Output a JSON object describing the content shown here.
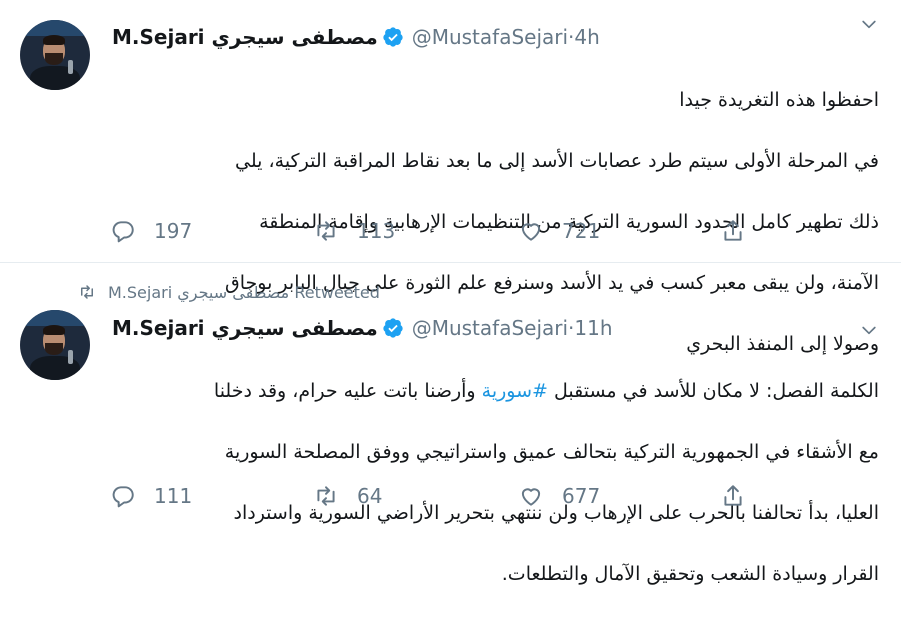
{
  "tweets": [
    {
      "display_name": "M.Sejari مصطفى سيجري",
      "handle": "@MustafaSejari",
      "time": "4h",
      "lines": [
        "احفظوا هذه التغريدة جيدا",
        "في المرحلة الأولى سيتم طرد عصابات الأسد إلى ما بعد نقاط المراقبة التركية، يلي",
        "ذلك تطهير كامل الحدود السورية التركية من التنظيمات الإرهابية وإقامة المنطقة",
        "الآمنة، ولن يبقى معبر كسب في يد الأسد وسنرفع علم الثورة على جبال البابر بوجاق",
        "وصولا إلى المنفذ البحري"
      ],
      "replies": "197",
      "retweets": "113",
      "likes": "721"
    },
    {
      "retweet_context": "M.Sejari مصطفى سيجري Retweeted",
      "display_name": "M.Sejari مصطفى سيجري",
      "handle": "@MustafaSejari",
      "time": "11h",
      "line1_before": "الكلمة الفصل: لا مكان للأسد في مستقبل ",
      "hashtag": "#سورية",
      "line1_after": " وأرضنا باتت عليه حرام، وقد دخلنا",
      "lines": [
        "مع الأشقاء في الجمهورية التركية بتحالف عميق واستراتيجي ووفق المصلحة السورية",
        "العليا، بدأ تحالفنا بالحرب على الإرهاب ولن ننتهي بتحرير الأراضي السورية واسترداد",
        "القرار وسيادة الشعب وتحقيق الآمال والتطلعات."
      ],
      "replies": "111",
      "retweets": "64",
      "likes": "677"
    }
  ],
  "separator": " · ",
  "icons": {
    "verified": "verified-badge-icon",
    "caret": "chevron-down-icon",
    "reply": "reply-icon",
    "retweet": "retweet-icon",
    "like": "heart-icon",
    "share": "share-icon"
  },
  "colors": {
    "accent": "#1da1f2",
    "hashtag": "#1b95e0",
    "secondary_text": "#657786",
    "divider": "#e6ecf0"
  }
}
